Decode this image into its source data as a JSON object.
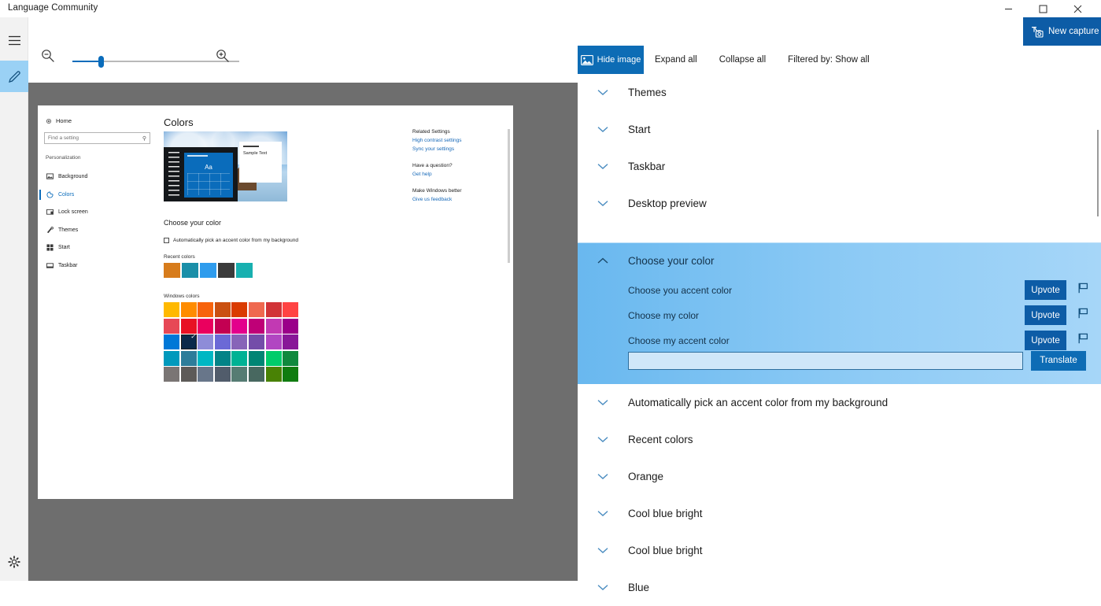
{
  "window": {
    "title": "Language Community",
    "minimize_label": "─",
    "maximize_label": "□",
    "close_label": "✕"
  },
  "new_capture": {
    "label": "New capture",
    "icon": "translate-camera-icon",
    "color": "#0d5ca6"
  },
  "rail": {
    "items": [
      {
        "name": "hamburger-menu",
        "icon": "hamburger-icon"
      },
      {
        "name": "pen-tool",
        "icon": "pen-icon",
        "selected": true,
        "highlight": "#9ad1f5"
      },
      {
        "name": "settings",
        "icon": "gear-icon"
      }
    ]
  },
  "zoom_toolbar": {
    "zoom_out_icon": "zoom-out-icon",
    "zoom_in_icon": "zoom-in-icon",
    "slider_value": 18,
    "slider_min": 0,
    "slider_max": 100,
    "accent": "#0a6cbb"
  },
  "pane": {
    "toolbar": {
      "hide_image": "Hide image",
      "hide_image_icon": "image-icon",
      "expand_all": "Expand all",
      "collapse_all": "Collapse all",
      "filtered_by": "Filtered by: Show all"
    },
    "rows_above": [
      {
        "label": "Themes",
        "chevron": "chevron-down-icon"
      },
      {
        "label": "Start",
        "chevron": "chevron-down-icon"
      },
      {
        "label": "Taskbar",
        "chevron": "chevron-down-icon"
      },
      {
        "label": "Desktop preview",
        "chevron": "chevron-down-icon"
      }
    ],
    "expanded_group": {
      "label": "Choose your color",
      "chevron": "chevron-up-icon",
      "suggestions": [
        {
          "text": "Choose you accent color",
          "upvote": "Upvote",
          "flag": "flag-icon"
        },
        {
          "text": "Choose my color",
          "upvote": "Upvote",
          "flag": "flag-icon"
        },
        {
          "text": "Choose my accent color",
          "upvote": "Upvote",
          "flag": "flag-icon"
        }
      ],
      "input_value": "",
      "input_placeholder": "",
      "translate_label": "Translate"
    },
    "rows_below": [
      {
        "label": "Automatically pick an accent color from my background",
        "chevron": "chevron-down-icon"
      },
      {
        "label": "Recent colors",
        "chevron": "chevron-down-icon"
      },
      {
        "label": "Orange",
        "chevron": "chevron-down-icon"
      },
      {
        "label": "Cool blue bright",
        "chevron": "chevron-down-icon"
      },
      {
        "label": "Cool blue bright",
        "chevron": "chevron-down-icon"
      },
      {
        "label": "Blue",
        "chevron": "chevron-down-icon"
      }
    ]
  },
  "screenshot": {
    "nav": {
      "home": "Home",
      "home_icon": "home-gear-icon",
      "search_placeholder": "Find a setting",
      "search_value": "",
      "search_icon": "search-icon",
      "group_label": "Personalization",
      "items": [
        {
          "label": "Background",
          "icon": "background-icon",
          "selected": false
        },
        {
          "label": "Colors",
          "icon": "colors-icon",
          "selected": true
        },
        {
          "label": "Lock screen",
          "icon": "lock-screen-icon",
          "selected": false
        },
        {
          "label": "Themes",
          "icon": "themes-icon",
          "selected": false
        },
        {
          "label": "Start",
          "icon": "start-icon",
          "selected": false
        },
        {
          "label": "Taskbar",
          "icon": "taskbar-icon",
          "selected": false
        }
      ]
    },
    "page_title": "Colors",
    "preview": {
      "tile_text": "Aa",
      "window_text": "Sample Text"
    },
    "choose_your_color": "Choose your color",
    "auto_pick_label": "Automatically pick an accent color from my background",
    "auto_pick_checked": false,
    "recent_colors_label": "Recent colors",
    "recent_colors": [
      "#d77c1c",
      "#1a8fa8",
      "#2f9ced",
      "#3b3b3b",
      "#18b0b0"
    ],
    "windows_colors_label": "Windows colors",
    "windows_colors": [
      [
        "#ffb900",
        "#ff8c00",
        "#f7630c",
        "#ca5010",
        "#da3b01",
        "#ef6950",
        "#d13438",
        "#ff4343"
      ],
      [
        "#e74856",
        "#e81123",
        "#ea005e",
        "#c30052",
        "#e3008c",
        "#bf0077",
        "#c239b3",
        "#9a0089"
      ],
      [
        "#0078d7",
        "#0b2a4a",
        "#8e8cd8",
        "#6b69d6",
        "#8764b8",
        "#744da9",
        "#b146c2",
        "#881798"
      ],
      [
        "#0099bc",
        "#2d7d9a",
        "#00b7c3",
        "#038387",
        "#00b294",
        "#018574",
        "#00cc6a",
        "#10893e"
      ],
      [
        "#7a7574",
        "#5d5a58",
        "#68768a",
        "#515c6b",
        "#567c73",
        "#486860",
        "#498205",
        "#107c10"
      ]
    ],
    "selected_swatch": {
      "row": 2,
      "col": 1,
      "check": "✓"
    },
    "side": [
      {
        "heading": "Related Settings",
        "links": [
          "High contrast settings",
          "Sync your settings"
        ]
      },
      {
        "heading": "Have a question?",
        "links": [
          "Get help"
        ]
      },
      {
        "heading": "Make Windows better",
        "links": [
          "Give us feedback"
        ]
      }
    ]
  }
}
